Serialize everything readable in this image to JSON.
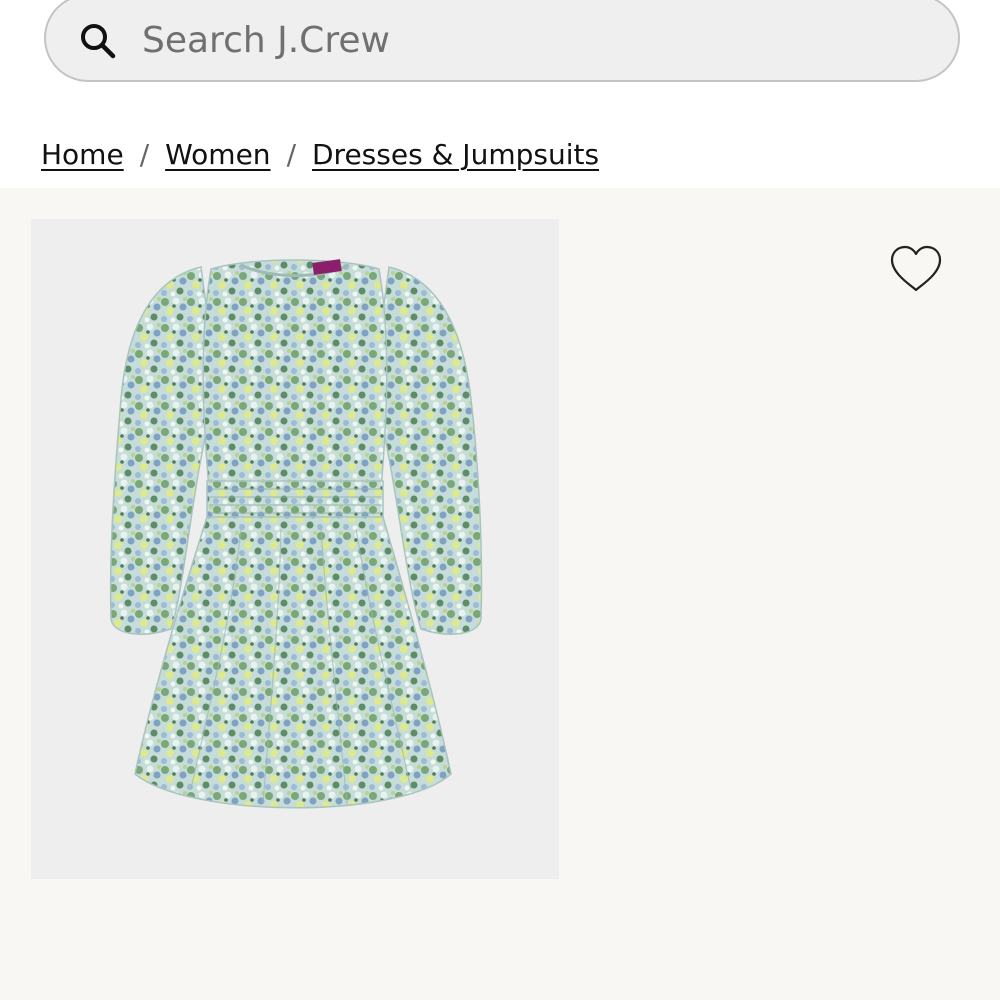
{
  "search": {
    "placeholder": "Search J.Crew",
    "value": "",
    "icon": "search-icon"
  },
  "breadcrumb": {
    "items": [
      {
        "label": "Home"
      },
      {
        "label": "Women"
      },
      {
        "label": "Dresses & Jumpsuits"
      }
    ],
    "separator": "/"
  },
  "product": {
    "image_alt": "Long-sleeve floral mini dress",
    "wishlist_icon": "heart-outline-icon"
  },
  "colors": {
    "page_bg": "#ffffff",
    "product_bg": "#f8f7f4",
    "image_bg": "#eeeeef",
    "search_bg": "#efefef",
    "search_border": "#c4c4c4",
    "dress_base": "#c5dcd9",
    "dress_green": "#7aa776",
    "dress_blue": "#7fa2c4",
    "dress_lime": "#dce98f",
    "label_purple": "#8c1f6b"
  }
}
